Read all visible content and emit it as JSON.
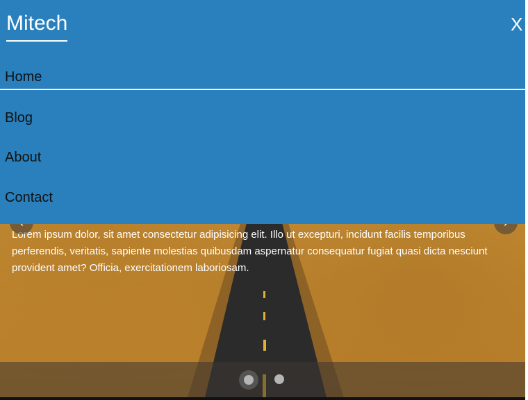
{
  "nav": {
    "brand": "Mitech",
    "close_label": "X",
    "items": [
      {
        "label": "Home"
      },
      {
        "label": "Blog"
      },
      {
        "label": "About"
      },
      {
        "label": "Contact"
      }
    ]
  },
  "hero": {
    "caption": "Lorem ipsum dolor, sit amet consectetur adipisicing elit. Illo ut excepturi, incidunt facilis temporibus perferendis, veritatis, sapiente molestias quibusdam aspernatur consequatur fugiat quasi dicta nesciunt provident amet? Officia, exercitationem laboriosam.",
    "prev_icon": "chevron-left-icon",
    "next_icon": "chevron-right-icon",
    "slide_count": 2,
    "active_slide": 1
  },
  "colors": {
    "nav_background": "#2980bd",
    "nav_text": "#111111",
    "brand_text": "#ffffff"
  }
}
